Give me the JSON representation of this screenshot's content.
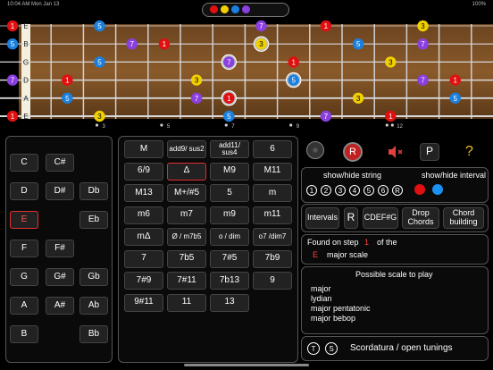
{
  "status": {
    "time": "10:04 AM  Mon Jan 13",
    "battery": "100%"
  },
  "palette_colors": [
    "#e01010",
    "#f0d000",
    "#1a80e0",
    "#8a3fe0"
  ],
  "fretboard": {
    "strings": [
      "E",
      "B",
      "G",
      "D",
      "A",
      "E"
    ],
    "fret_markers": [
      "3",
      "5",
      "7",
      "9",
      "12"
    ],
    "notes": [
      {
        "s": 0,
        "f": 0,
        "l": "1",
        "c": "r"
      },
      {
        "s": 0,
        "f": 3,
        "l": "5",
        "c": "b"
      },
      {
        "s": 0,
        "f": 8,
        "l": "7",
        "c": "p"
      },
      {
        "s": 0,
        "f": 10,
        "l": "1",
        "c": "r"
      },
      {
        "s": 0,
        "f": 13,
        "l": "3",
        "c": "y"
      },
      {
        "s": 1,
        "f": 0,
        "l": "5",
        "c": "b"
      },
      {
        "s": 1,
        "f": 4,
        "l": "7",
        "c": "p"
      },
      {
        "s": 1,
        "f": 5,
        "l": "1",
        "c": "r"
      },
      {
        "s": 1,
        "f": 8,
        "l": "3",
        "c": "y",
        "h": 1
      },
      {
        "s": 1,
        "f": 11,
        "l": "5",
        "c": "b"
      },
      {
        "s": 1,
        "f": 13,
        "l": "7",
        "c": "p"
      },
      {
        "s": 2,
        "f": 3,
        "l": "5",
        "c": "b"
      },
      {
        "s": 2,
        "f": 7,
        "l": "7",
        "c": "p",
        "h": 1
      },
      {
        "s": 2,
        "f": 9,
        "l": "1",
        "c": "r"
      },
      {
        "s": 2,
        "f": 12,
        "l": "3",
        "c": "y"
      },
      {
        "s": 3,
        "f": 0,
        "l": "7",
        "c": "p"
      },
      {
        "s": 3,
        "f": 2,
        "l": "1",
        "c": "r"
      },
      {
        "s": 3,
        "f": 6,
        "l": "3",
        "c": "y"
      },
      {
        "s": 3,
        "f": 9,
        "l": "5",
        "c": "b",
        "h": 1
      },
      {
        "s": 3,
        "f": 13,
        "l": "7",
        "c": "p"
      },
      {
        "s": 3,
        "f": 14,
        "l": "1",
        "c": "r"
      },
      {
        "s": 4,
        "f": 2,
        "l": "5",
        "c": "b"
      },
      {
        "s": 4,
        "f": 6,
        "l": "7",
        "c": "p"
      },
      {
        "s": 4,
        "f": 7,
        "l": "1",
        "c": "r",
        "h": 1
      },
      {
        "s": 4,
        "f": 11,
        "l": "3",
        "c": "y"
      },
      {
        "s": 4,
        "f": 14,
        "l": "5",
        "c": "b"
      },
      {
        "s": 5,
        "f": 0,
        "l": "1",
        "c": "r"
      },
      {
        "s": 5,
        "f": 3,
        "l": "3",
        "c": "y"
      },
      {
        "s": 5,
        "f": 7,
        "l": "5",
        "c": "b"
      },
      {
        "s": 5,
        "f": 10,
        "l": "7",
        "c": "p"
      },
      {
        "s": 5,
        "f": 12,
        "l": "1",
        "c": "r"
      }
    ]
  },
  "notes_panel": [
    "C",
    "C#",
    "D",
    "D#",
    "Db",
    "E",
    "Eb",
    "F",
    "F#",
    "G",
    "G#",
    "Gb",
    "A",
    "A#",
    "Ab",
    "B",
    "Bb"
  ],
  "chord_types": [
    "M",
    "add9/ sus2",
    "add11/ sus4",
    "6",
    "6/9",
    "Δ",
    "M9",
    "M11",
    "M13",
    "M+/#5",
    "5",
    "m",
    "m6",
    "m7",
    "m9",
    "m11",
    "mΔ",
    "Ø / m7b5",
    "o / dim",
    "o7 /dim7",
    "7",
    "7b5",
    "7#5",
    "7b9",
    "7#9",
    "7#11",
    "7b13",
    "9",
    "9#11",
    "11",
    "13"
  ],
  "top_controls": {
    "record_label": "R",
    "p_label": "P",
    "help_label": "?"
  },
  "string_filter": {
    "label": "show/hide string",
    "strings": [
      "1",
      "2",
      "3",
      "4",
      "5",
      "6"
    ],
    "root": "R"
  },
  "interval_filter": {
    "label": "show/hide interval",
    "colors": [
      "#e01010",
      "#1a80e0"
    ]
  },
  "buttons": {
    "intervals": "Intervals",
    "r": "R",
    "cdefg": "CDEF#G",
    "drop_chords": "Drop Chords",
    "chord_building": "Chord building"
  },
  "found": {
    "prefix": "Found on step",
    "step": "1",
    "suffix": "of the",
    "root": "E",
    "scale": "major scale"
  },
  "possible": {
    "title": "Possible scale to play",
    "items": [
      "major",
      "lydian",
      "major pentatonic",
      "major bebop"
    ]
  },
  "tuning": {
    "t": "T",
    "s": "S",
    "label": "Scordatura / open tunings"
  }
}
